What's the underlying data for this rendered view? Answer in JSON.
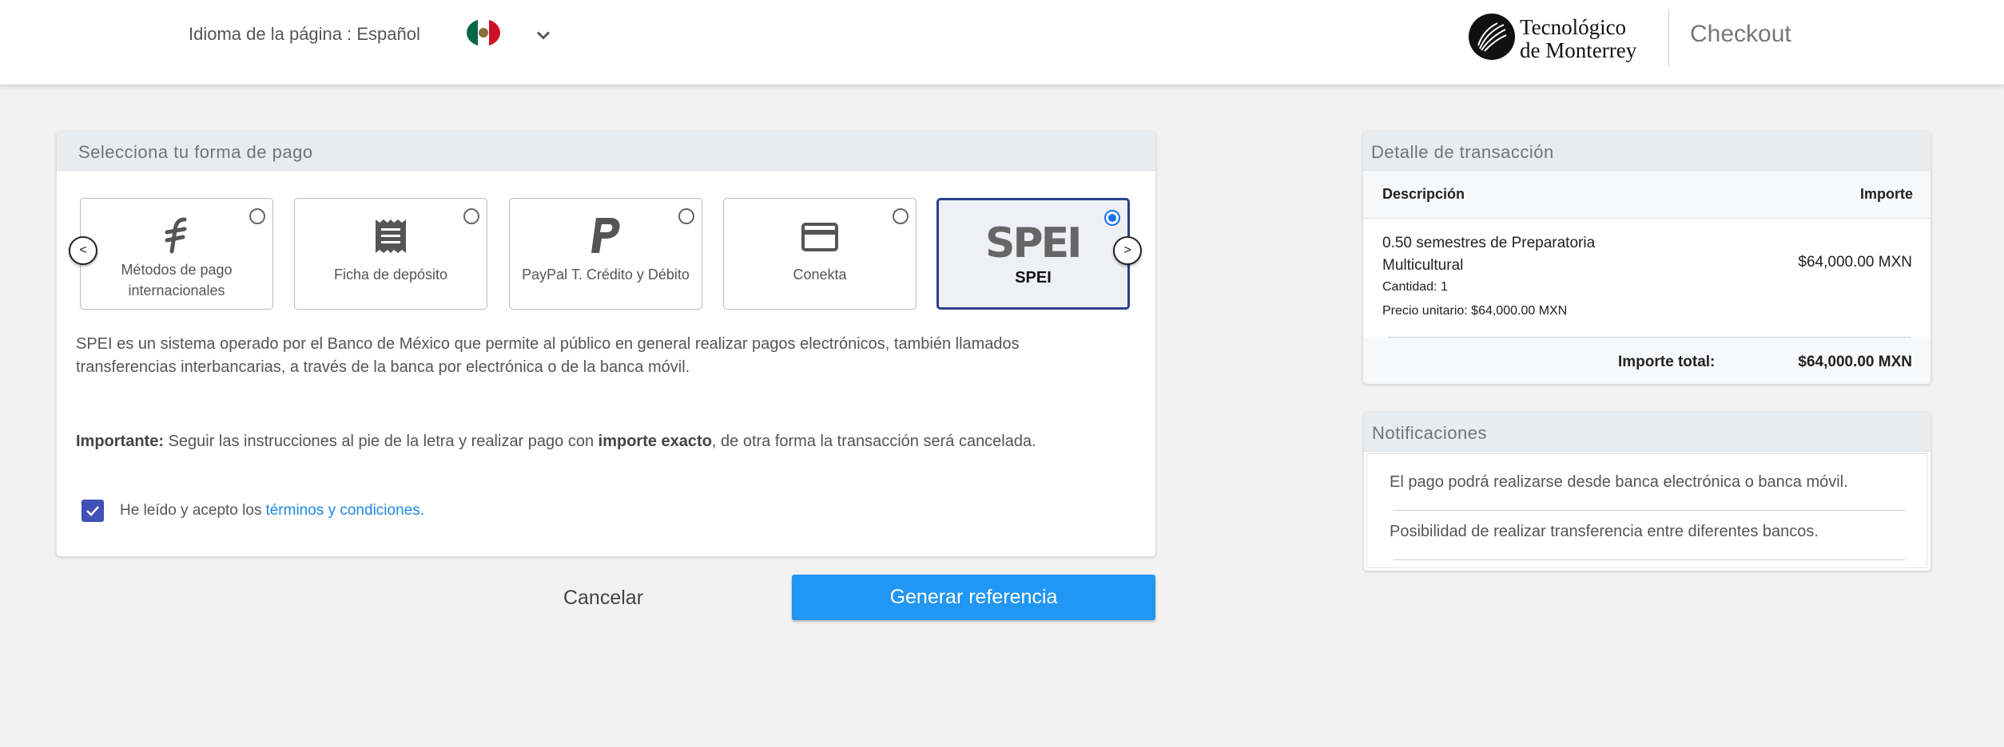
{
  "header": {
    "language_label": "Idioma de la página : Español",
    "logo_line1": "Tecnológico",
    "logo_line2": "de Monterrey",
    "title": "Checkout"
  },
  "payment": {
    "heading": "Selecciona tu forma de pago",
    "prev_arrow": "<",
    "next_arrow": ">",
    "methods": [
      {
        "label": "Métodos de pago internacionales",
        "icon": "flywire-icon",
        "selected": false
      },
      {
        "label": "Ficha de depósito",
        "icon": "receipt-icon",
        "selected": false
      },
      {
        "label": "PayPal T. Crédito y Débito",
        "icon": "paypal-icon",
        "selected": false
      },
      {
        "label": "Conekta",
        "icon": "credit-card-icon",
        "selected": false
      },
      {
        "label": "SPEI",
        "logo": "SPEI",
        "icon": "spei-logo",
        "selected": true
      }
    ],
    "description": "SPEI es un sistema operado por el Banco de México que permite al público en general realizar pagos electrónicos, también llamados transferencias interbancarias, a través de la banca por electrónica o de la banca móvil.",
    "important_label": "Importante:",
    "important_text_1": "Seguir las instrucciones al pie de la letra y realizar pago con",
    "important_bold": "importe exacto",
    "important_text_2": ", de otra forma la transacción será cancelada.",
    "terms_text": "He leído y acepto los",
    "terms_link": "términos y condiciones.",
    "terms_checked": true
  },
  "actions": {
    "cancel_label": "Cancelar",
    "generate_label": "Generar referencia"
  },
  "transaction": {
    "heading": "Detalle de transacción",
    "col_description": "Descripción",
    "col_amount": "Importe",
    "item_description": "0.50 semestres de Preparatoria Multicultural",
    "item_quantity": "Cantidad: 1",
    "item_unit_price": "Precio unitario: $64,000.00 MXN",
    "item_amount": "$64,000.00 MXN",
    "total_label": "Importe total:",
    "total_amount": "$64,000.00 MXN"
  },
  "notifications": {
    "heading": "Notificaciones",
    "items": [
      "El pago podrá realizarse desde banca electrónica o banca móvil.",
      "Posibilidad de realizar transferencia entre diferentes bancos."
    ]
  },
  "colors": {
    "primary_button": "#2196f3",
    "selected_border": "#2c3f8f",
    "checkbox": "#3f51b5",
    "link": "#1e88e5"
  }
}
